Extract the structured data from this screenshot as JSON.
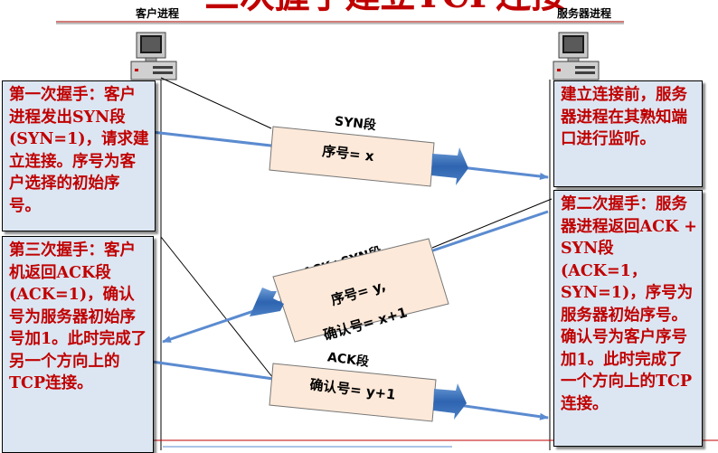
{
  "title": "三次握手建立TCP连接",
  "client_label": "客户进程",
  "server_label": "服务器进程",
  "segments": {
    "syn": {
      "title": "SYN段",
      "line1": "序号= x"
    },
    "ack_syn": {
      "title": "ACK+SYN段",
      "line1": "序号= y,",
      "line2": "确认号= x+1"
    },
    "ack": {
      "title": "ACK段",
      "line1": "确认号= y+1"
    }
  },
  "notes": {
    "first": "第一次握手：客户进程发出SYN段(SYN=1)，请求建立连接。序号为客户选择的初始序号。",
    "third": "第三次握手：客户机返回ACK段(ACK=1)，确认号为服务器初始序号加1。此时完成了另一个方向上的TCP连接。",
    "listen": "建立连接前，服务器进程在其熟知端口进行监听。",
    "second": "第二次握手：服务器进程返回ACK + SYN段(ACK=1，SYN=1)，序号为服务器初始序号。确认号为客户序号加1。此时完成了一个方向上的TCP连接。"
  },
  "colors": {
    "accent_red": "#c00000",
    "note_bg": "#dce6f2",
    "arrow_blue": "#5b8bd0",
    "segment_bg": "#fde9d9"
  }
}
